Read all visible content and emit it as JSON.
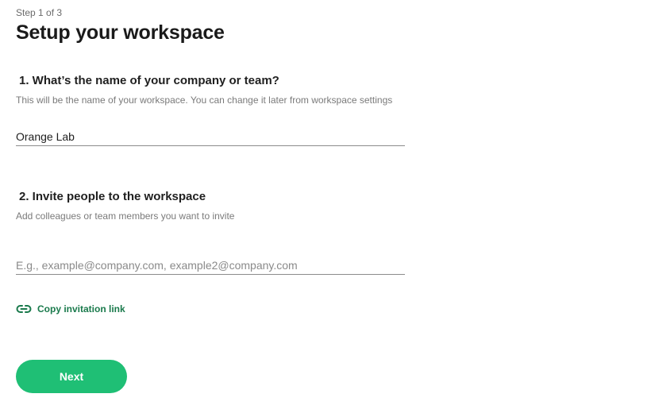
{
  "header": {
    "step": "Step 1 of 3",
    "title": "Setup your workspace"
  },
  "question1": {
    "title": "1. What’s the name of your company or team?",
    "hint": "This will be the name of your workspace. You can change it later from workspace settings",
    "value": "Orange Lab",
    "placeholder": ""
  },
  "question2": {
    "title": "2. Invite people to the workspace",
    "hint": "Add colleagues or team members you want to invite",
    "value": "",
    "placeholder": "E.g., example@company.com, example2@company.com"
  },
  "copy_link": {
    "label": "Copy invitation link",
    "icon": "link-icon"
  },
  "actions": {
    "next_label": "Next"
  },
  "colors": {
    "accent": "#1fbf75",
    "link": "#1a7a4c"
  }
}
